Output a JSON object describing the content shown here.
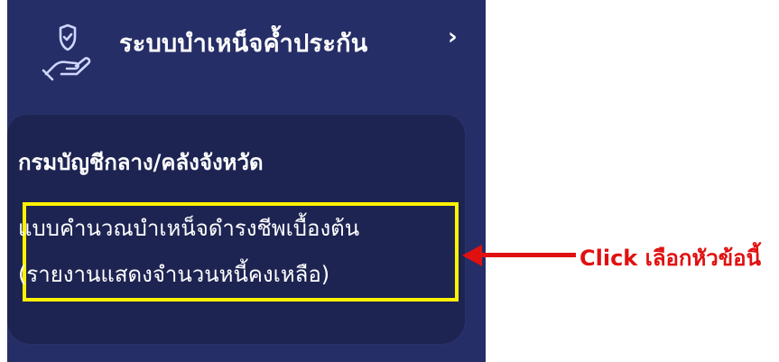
{
  "sidebar": {
    "menu": {
      "title": "ระบบบำเหน็จค้ำประกัน",
      "icon": "hand-shield-icon",
      "expand_icon": "chevron-right-icon"
    },
    "submenu": {
      "heading": "กรมบัญชีกลาง/คลังจังหวัด",
      "item": {
        "line1": "แบบคำนวณบำเหน็จดำรงชีพเบื้องต้น",
        "line2": "(รายงานแสดงจำนวนหนี้คงเหลือ)"
      }
    }
  },
  "annotation": {
    "text": "Click เลือกหัวข้อนี้",
    "color": "#e01010",
    "highlight_color": "#fff200"
  }
}
